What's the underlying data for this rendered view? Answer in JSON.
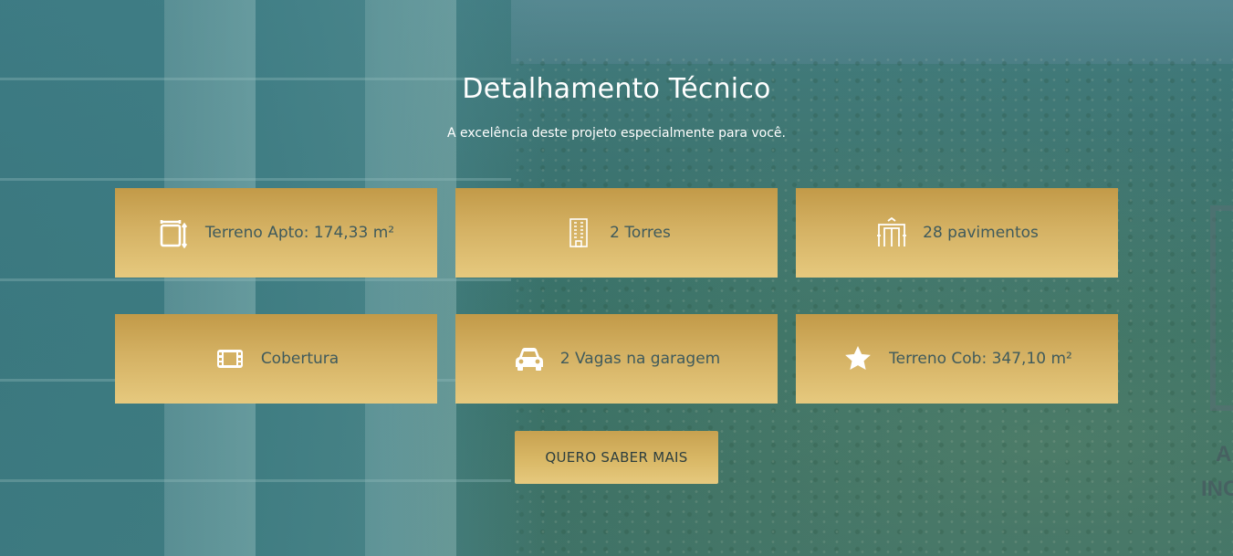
{
  "section": {
    "title": "Detalhamento Técnico",
    "subtitle": "A excelência deste projeto especialmente para você."
  },
  "features": [
    {
      "label": "Terreno Apto: 174,33 m²",
      "icon": "floorplan-icon"
    },
    {
      "label": "2 Torres",
      "icon": "building-icon"
    },
    {
      "label": "28 pavimentos",
      "icon": "elevator-icon"
    },
    {
      "label": "Cobertura",
      "icon": "film-icon"
    },
    {
      "label": "2 Vagas na garagem",
      "icon": "car-icon"
    },
    {
      "label": "Terreno Cob: 347,10 m²",
      "icon": "star-icon"
    }
  ],
  "cta": {
    "label": "QUERO SABER MAIS"
  },
  "background_side_text": [
    "A",
    "INC"
  ],
  "colors": {
    "card_gold_top": "#c29a48",
    "card_gold_bottom": "#e6c97e",
    "card_text": "#3f5a5c",
    "background_teal": "#2f6468",
    "heading_text": "#ffffff"
  }
}
